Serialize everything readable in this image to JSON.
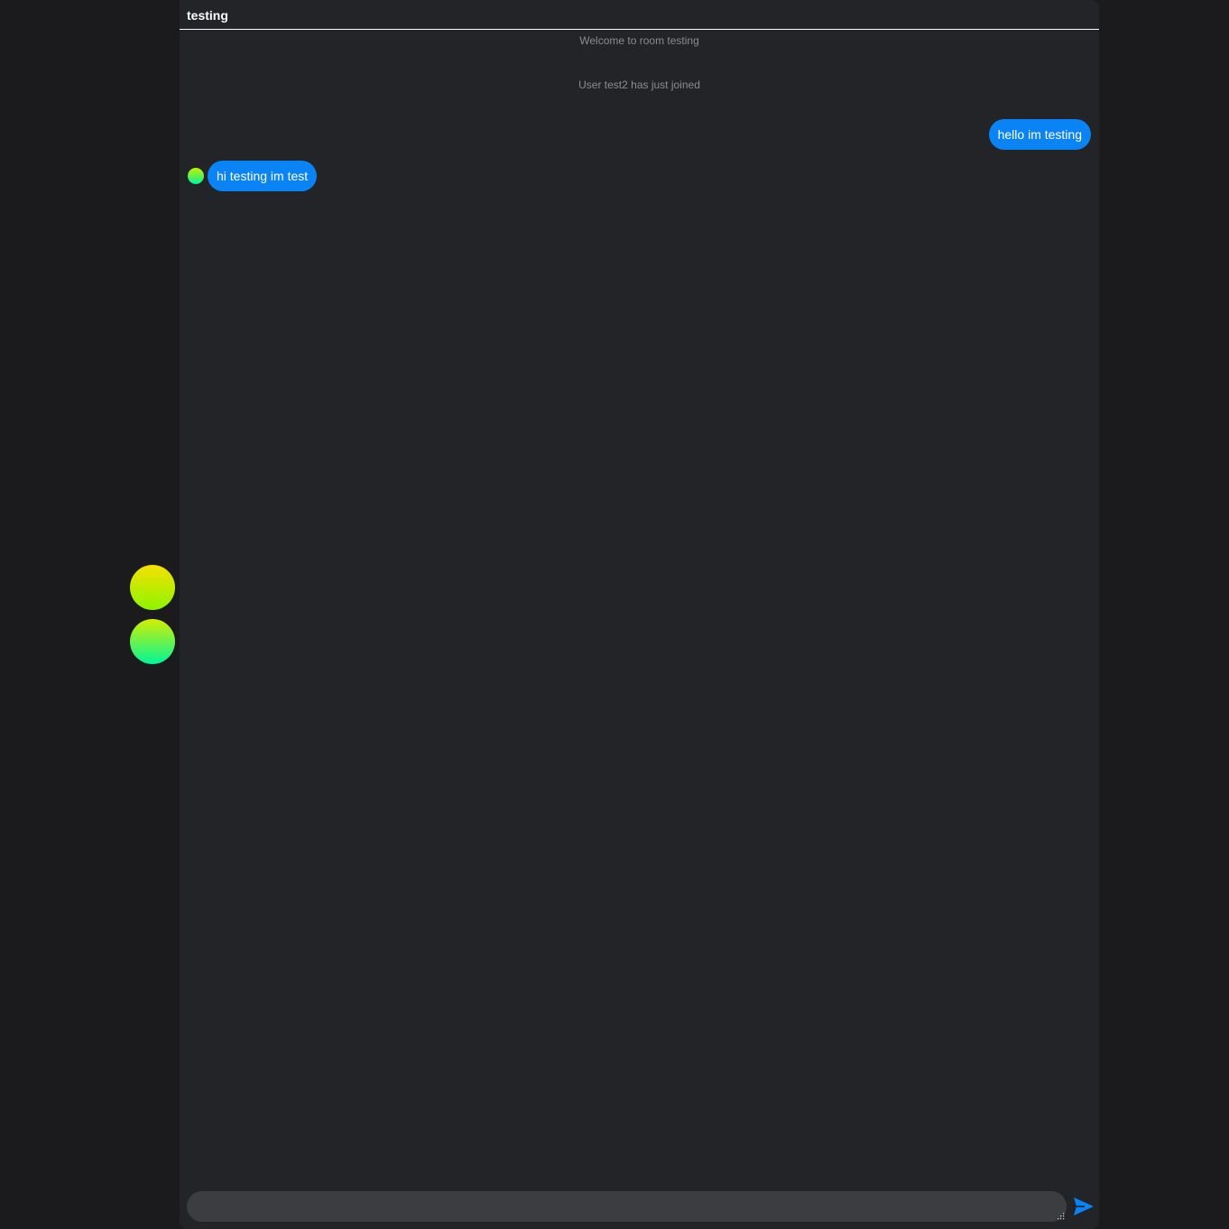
{
  "room": {
    "title": "testing"
  },
  "system_messages": [
    "Welcome to room testing",
    "User test2 has just joined"
  ],
  "messages": [
    {
      "direction": "outgoing",
      "text": "hello im testing"
    },
    {
      "direction": "incoming",
      "text": "hi testing im test"
    }
  ],
  "composer": {
    "value": "",
    "placeholder": ""
  },
  "icons": {
    "send": "send-icon",
    "resize": "resize-grip-icon"
  },
  "colors": {
    "background": "#1b1b1d",
    "panel": "#232427",
    "bubble": "#0a84f5",
    "input": "#3c3d40",
    "system_text": "#8b8c90"
  }
}
